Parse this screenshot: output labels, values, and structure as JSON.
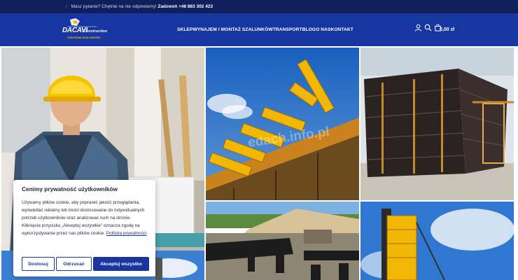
{
  "topbar": {
    "question": "Masz pytanie? Chętnie na nie odpowiemy!",
    "call_label": "Zadzwoń",
    "phone": "+48 883 302 423"
  },
  "header": {
    "logo_text": "DACAVI",
    "logo_sub": "Construction",
    "logo_tagline": "CENTRUM SZALUNKÓW",
    "nav": [
      "SKLEP",
      "WYNAJEM I MONTAŻ SZALUNKÓW",
      "TRANSPORT",
      "BLOG",
      "O NAS",
      "KONTAKT"
    ],
    "cart_total": "0,00 zł"
  },
  "gallery": {
    "watermark": "edach.info.pl"
  },
  "cookie": {
    "title": "Cenimy prywatność użytkowników",
    "body": "Używamy plików cookie, aby poprawić jakość przeglądania, wyświetlać reklamy lub treści dostosowane do indywidualnych potrzeb użytkowników oraz analizować ruch na stronie. Kliknięcie przycisku „Akceptuj wszystkie” oznacza zgodę na wykorzystywanie przez nas plików cookie.",
    "policy_link": "Polityka prywatności",
    "customize": "Dostosuj",
    "reject": "Odrzucać",
    "accept_all": "Akceptuj wszystko"
  },
  "colors": {
    "topbar": "#0f1f5c",
    "header": "#1836a2",
    "accent": "#1836a2",
    "timber_yellow": "#f2b705"
  },
  "icons": [
    "user-icon",
    "search-icon",
    "cart-icon"
  ]
}
